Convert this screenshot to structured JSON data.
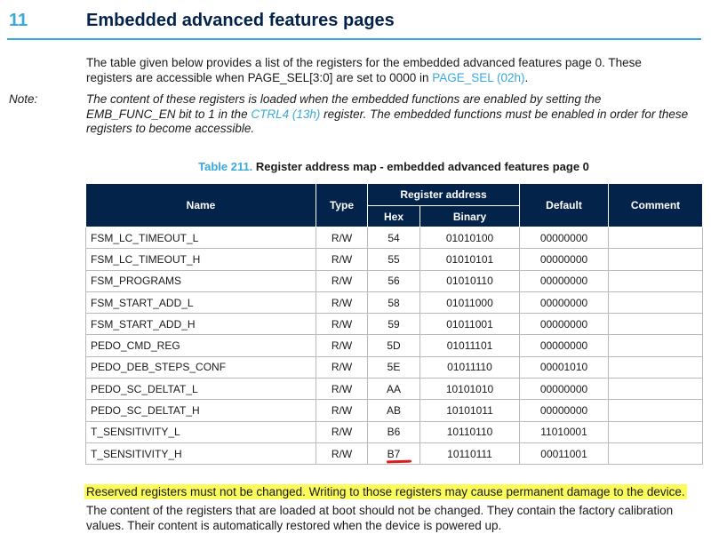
{
  "section": {
    "number": "11",
    "title": "Embedded advanced features pages"
  },
  "intro": {
    "text_before_link": "The table given below provides a list of the registers for the embedded advanced features page 0. These registers are accessible when PAGE_SEL[3:0] are set to 0000 in ",
    "link": "PAGE_SEL (02h)",
    "text_after_link": "."
  },
  "note": {
    "label": "Note:",
    "text_before_link": "The content of these registers is loaded when the embedded functions are enabled by setting the EMB_FUNC_EN bit to 1 in the ",
    "link": "CTRL4 (13h)",
    "text_after_link": " register. The embedded functions must be enabled in order for these registers to become accessible."
  },
  "table": {
    "caption_number": "Table 211.",
    "caption_title": "Register address map - embedded advanced features page 0",
    "headers": {
      "name": "Name",
      "type": "Type",
      "register_address": "Register address",
      "hex": "Hex",
      "binary": "Binary",
      "default": "Default",
      "comment": "Comment"
    },
    "rows": [
      {
        "name": "FSM_LC_TIMEOUT_L",
        "type": "R/W",
        "hex": "54",
        "binary": "01010100",
        "default": "00000000",
        "comment": ""
      },
      {
        "name": "FSM_LC_TIMEOUT_H",
        "type": "R/W",
        "hex": "55",
        "binary": "01010101",
        "default": "00000000",
        "comment": ""
      },
      {
        "name": "FSM_PROGRAMS",
        "type": "R/W",
        "hex": "56",
        "binary": "01010110",
        "default": "00000000",
        "comment": ""
      },
      {
        "name": "FSM_START_ADD_L",
        "type": "R/W",
        "hex": "58",
        "binary": "01011000",
        "default": "00000000",
        "comment": ""
      },
      {
        "name": "FSM_START_ADD_H",
        "type": "R/W",
        "hex": "59",
        "binary": "01011001",
        "default": "00000000",
        "comment": ""
      },
      {
        "name": "PEDO_CMD_REG",
        "type": "R/W",
        "hex": "5D",
        "binary": "01011101",
        "default": "00000000",
        "comment": ""
      },
      {
        "name": "PEDO_DEB_STEPS_CONF",
        "type": "R/W",
        "hex": "5E",
        "binary": "01011110",
        "default": "00001010",
        "comment": ""
      },
      {
        "name": "PEDO_SC_DELTAT_L",
        "type": "R/W",
        "hex": "AA",
        "binary": "10101010",
        "default": "00000000",
        "comment": ""
      },
      {
        "name": "PEDO_SC_DELTAT_H",
        "type": "R/W",
        "hex": "AB",
        "binary": "10101011",
        "default": "00000000",
        "comment": ""
      },
      {
        "name": "T_SENSITIVITY_L",
        "type": "R/W",
        "hex": "B6",
        "binary": "10110110",
        "default": "11010001",
        "comment": ""
      },
      {
        "name": "T_SENSITIVITY_H",
        "type": "R/W",
        "hex": "B7",
        "binary": "10110111",
        "default": "00011001",
        "comment": ""
      }
    ]
  },
  "warning": "Reserved registers must not be changed. Writing to those registers may cause permanent damage to the device.",
  "boot_note": "The content of the registers that are loaded at boot should not be changed. They contain the factory calibration values. Their content is automatically restored when the device is powered up.",
  "colors": {
    "accent": "#39a9dc",
    "header_bg": "#03234b",
    "highlight": "#fbfb5c",
    "annotation_red": "#e11b1b"
  }
}
